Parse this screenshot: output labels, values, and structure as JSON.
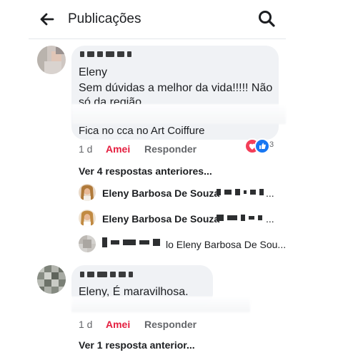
{
  "header": {
    "title": "Publicações"
  },
  "comments": [
    {
      "author": "Eleny",
      "line1": "Sem dúvidas a melhor da vida!!!!! Não",
      "line2": "só da região",
      "line3": "Fica no cca  no Art Coiffure",
      "time": "1 d",
      "like_label": "Amei",
      "reply_label": "Responder",
      "reaction_count": "3",
      "view_more": "Ver 4 respostas anteriores..."
    },
    {
      "text": "Eleny, É maravilhosa.",
      "time": "1 d",
      "like_label": "Amei",
      "reply_label": "Responder",
      "view_more": "Ver 1 resposta anterior..."
    }
  ],
  "replies": [
    {
      "name": "Eleny Barbosa De Souza",
      "suffix": "..."
    },
    {
      "name": "Eleny Barbosa De Souza",
      "suffix": "..."
    },
    {
      "name": "lo Eleny Barbosa De Sou...",
      "suffix": ""
    }
  ],
  "icons": {
    "back": "arrow-left-icon",
    "search": "search-icon",
    "love": "heart-reaction-icon",
    "like": "thumbs-up-reaction-icon"
  },
  "colors": {
    "amei": "#e41e3f",
    "bubble": "#f0f2f5",
    "muted": "#65676b",
    "like": "#1877f2"
  }
}
